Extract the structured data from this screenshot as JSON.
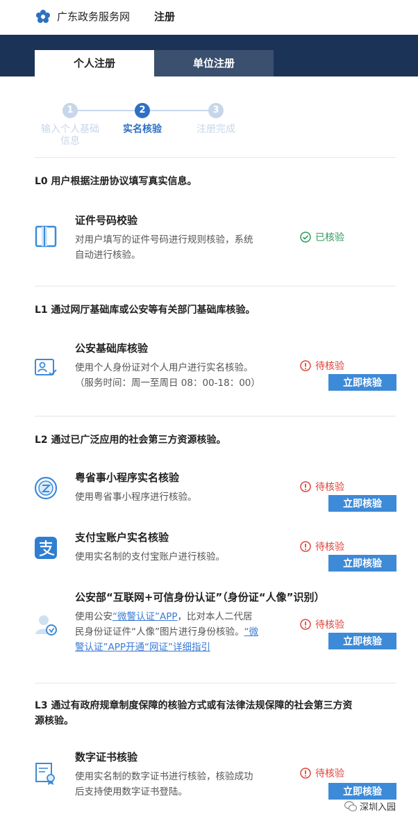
{
  "header": {
    "site_title": "广东政务服务网",
    "page_title": "注册"
  },
  "tabs": [
    {
      "label": "个人注册",
      "active": true
    },
    {
      "label": "单位注册",
      "active": false
    }
  ],
  "steps": [
    {
      "number": "1",
      "label_line1": "输入个人基础",
      "label_line2": "信息",
      "state": "done"
    },
    {
      "number": "2",
      "label_line1": "实名核验",
      "label_line2": "",
      "state": "current"
    },
    {
      "number": "3",
      "label_line1": "注册完成",
      "label_line2": "",
      "state": "pending"
    }
  ],
  "levels": [
    {
      "heading": "L0 用户根据注册协议填写真实信息。",
      "items": [
        {
          "icon": "id-card-icon",
          "title": "证件号码校验",
          "desc_line1": "对用户填写的证件号码进行规则核验，系统",
          "desc_line2": "自动进行核验。",
          "status": "已核验"
        }
      ]
    },
    {
      "heading": "L1 通过网厅基础库或公安等有关部门基础库核验。",
      "items": [
        {
          "icon": "person-card-icon",
          "title": "公安基础库核验",
          "desc_line1": "使用个人身份证对个人用户进行实名核验。",
          "desc_line2": "（服务时间：周一至周日 08：00-18：00）",
          "status": "待核验",
          "button": "立即核验"
        }
      ]
    },
    {
      "heading": "L2 通过已广泛应用的社会第三方资源核验。",
      "items": [
        {
          "icon": "yueshengshi-icon",
          "title": "粤省事小程序实名核验",
          "desc_line1": "使用粤省事小程序进行核验。",
          "status": "待核验",
          "button": "立即核验"
        },
        {
          "icon": "alipay-icon",
          "title": "支付宝账户实名核验",
          "desc_line1": "使用实名制的支付宝账户进行核验。",
          "status": "待核验",
          "button": "立即核验"
        },
        {
          "icon": "police-verify-icon",
          "title": "公安部“互联网+可信身份认证”（身份证“人像”识别）",
          "desc_a": "使用公安",
          "desc_link1": "“微警认证”APP",
          "desc_b": "，比对本人二代居",
          "desc_c": "民身份证证件“人像”图片进行身份核验。",
          "desc_link2a": "“微",
          "desc_link2b": "警认证”APP开通“网证”详细指引",
          "status": "待核验",
          "button": "立即核验"
        }
      ]
    },
    {
      "heading_line1": "L3 通过有政府规章制度保障的核验方式或有法律法规保障的社会第三方资",
      "heading_line2": "源核验。",
      "items": [
        {
          "icon": "digital-certificate-icon",
          "title": "数字证书核验",
          "desc_line1": "使用实名制的数字证书进行核验，核验成功",
          "desc_line2": "后支持使用数字证书登陆。",
          "status": "待核验",
          "button": "立即核验"
        }
      ]
    }
  ],
  "watermark": "深圳入园",
  "colors": {
    "nav_band": "#1c3358",
    "tab_inactive": "#3b4f6e",
    "step_active": "#2f6fc4",
    "step_inactive": "#c7d6ea",
    "button": "#3d8ad8",
    "status_ok": "#2e9c5b",
    "status_pending": "#e0443b"
  }
}
